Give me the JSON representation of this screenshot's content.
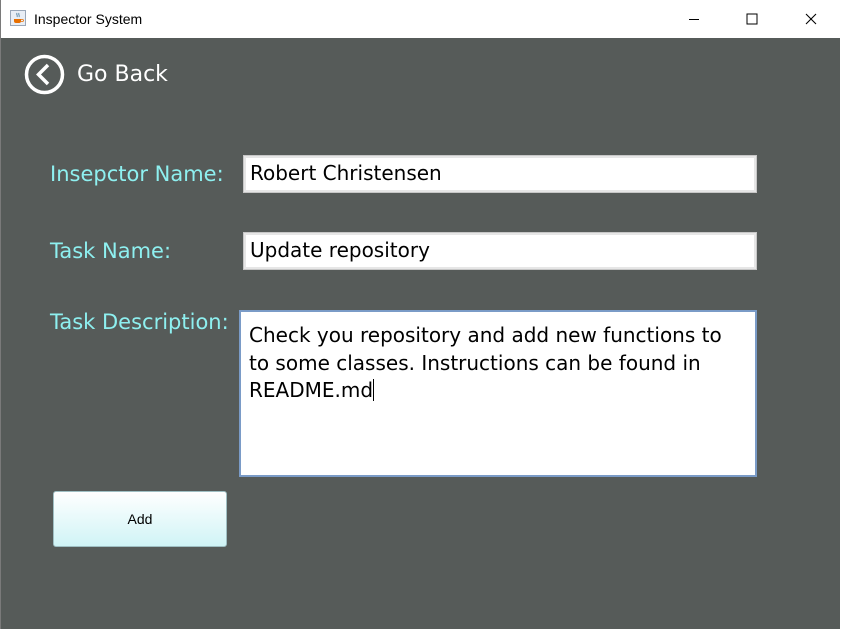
{
  "window": {
    "title": "Inspector System",
    "app_icon": "java-cup-icon",
    "controls": [
      "minimize-icon",
      "maximize-icon",
      "close-icon"
    ]
  },
  "nav": {
    "back_label": "Go Back",
    "back_icon": "chevron-left-circle-icon"
  },
  "form": {
    "inspector_label": "Insepctor Name:",
    "inspector_value": "Robert Christensen",
    "task_label": "Task Name:",
    "task_value": "Update repository",
    "description_label": "Task Description:",
    "description_value": "Check you repository and add new functions to\nto some classes. Instructions can be found in\nREADME.md"
  },
  "actions": {
    "add_label": "Add"
  },
  "colors": {
    "background": "#565b59",
    "label": "#8ef0f0",
    "button_top": "#ffffff",
    "button_bottom": "#d0f4f6"
  }
}
